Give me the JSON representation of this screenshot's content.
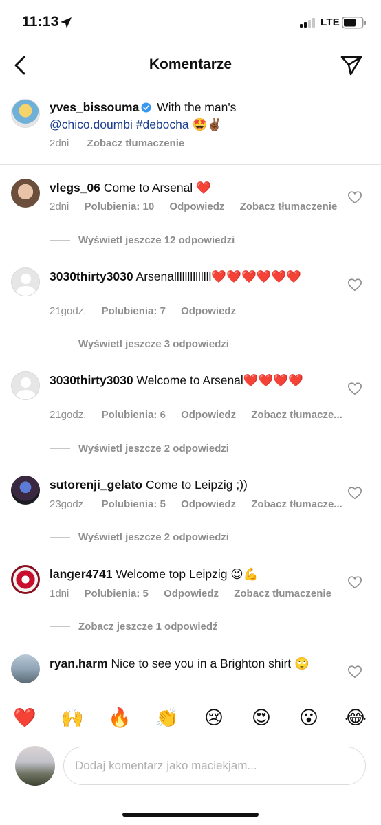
{
  "status": {
    "time": "11:13",
    "network": "LTE"
  },
  "header": {
    "title": "Komentarze"
  },
  "caption": {
    "username": "yves_bissouma",
    "text_before": "With the man's",
    "mention": "@chico.doumbi #debocha",
    "emojis": "🤩✌🏾",
    "time": "2dni",
    "translate": "Zobacz tłumaczenie"
  },
  "comments": [
    {
      "username": "vlegs_06",
      "text": "Come to Arsenal",
      "emoji": "❤️",
      "time": "2dni",
      "likes": "Polubienia: 10",
      "reply": "Odpowiedz",
      "translate": "Zobacz tłumaczenie",
      "more_replies": "Wyświetl jeszcze 12 odpowiedzi"
    },
    {
      "username": "3030thirty3030",
      "text": "Arsenallllllllllllll",
      "emoji": "❤️❤️❤️❤️❤️❤️",
      "time": "21godz.",
      "likes": "Polubienia: 7",
      "reply": "Odpowiedz",
      "more_replies": "Wyświetl jeszcze 3 odpowiedzi"
    },
    {
      "username": "3030thirty3030",
      "text": "Welcome to Arsenal",
      "emoji": "❤️❤️❤️❤️",
      "time": "21godz.",
      "likes": "Polubienia: 6",
      "reply": "Odpowiedz",
      "translate": "Zobacz tłumacze...",
      "more_replies": "Wyświetl jeszcze 2 odpowiedzi"
    },
    {
      "username": "sutorenji_gelato",
      "text": "Come to Leipzig ;))",
      "time": "23godz.",
      "likes": "Polubienia: 5",
      "reply": "Odpowiedz",
      "translate": "Zobacz tłumacze...",
      "more_replies": "Wyświetl jeszcze 2 odpowiedzi"
    },
    {
      "username": "langer4741",
      "text": "Welcome top Leipzig",
      "emoji": "😉💪",
      "time": "1dni",
      "likes": "Polubienia: 5",
      "reply": "Odpowiedz",
      "translate": "Zobacz tłumaczenie",
      "more_replies": "Zobacz jeszcze 1 odpowiedź"
    },
    {
      "username": "ryan.harm",
      "text": "Nice to see you in a Brighton shirt",
      "emoji": "🙄"
    }
  ],
  "emoji_bar": [
    "❤️",
    "🙌",
    "🔥",
    "👏",
    "😢",
    "😍",
    "😮",
    "😂"
  ],
  "input": {
    "placeholder": "Dodaj komentarz jako maciekjam..."
  }
}
